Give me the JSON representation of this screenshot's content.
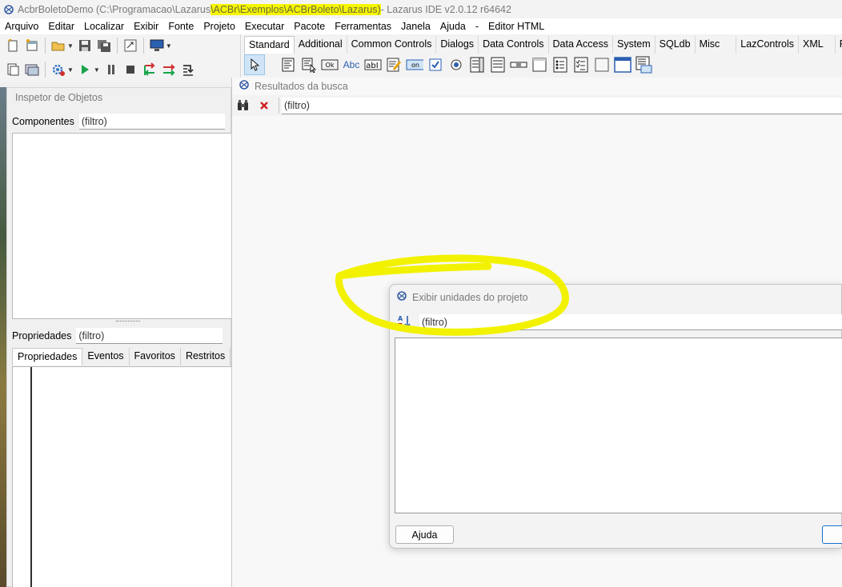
{
  "window": {
    "title_prefix": "AcbrBoletoDemo (C:\\Programacao\\Lazarus",
    "title_highlight": "\\ACBr\\Exemplos\\ACBrBoleto\\Lazarus)",
    "title_suffix": " - Lazarus IDE v2.0.12 r64642"
  },
  "menu": [
    "Arquivo",
    "Editar",
    "Localizar",
    "Exibir",
    "Fonte",
    "Projeto",
    "Executar",
    "Pacote",
    "Ferramentas",
    "Janela",
    "Ajuda",
    "-",
    "Editor HTML"
  ],
  "palette": {
    "tabs": [
      "Standard",
      "Additional",
      "Common Controls",
      "Dialogs",
      "Data Controls",
      "Data Access",
      "System",
      "SQLdb",
      "Misc",
      "LazControls",
      "XML",
      "Pasca"
    ],
    "active_tab": "Standard",
    "ok_label": "Ok",
    "abc_label": "Abc",
    "abi_label": "abI",
    "on_label": "on"
  },
  "inspector": {
    "title": "Inspetor de Objetos",
    "components_label": "Componentes",
    "components_filter": "(filtro)",
    "properties_label": "Propriedades",
    "properties_filter": "(filtro)",
    "tabs": [
      "Propriedades",
      "Eventos",
      "Favoritos",
      "Restritos"
    ]
  },
  "search_results": {
    "title": "Resultados da busca",
    "filter": "(filtro)"
  },
  "dialog": {
    "title": "Exibir unidades do projeto",
    "filter": "(filtro)",
    "help_button": "Ajuda"
  },
  "colors": {
    "highlight": "#f6f600",
    "annotation": "#f2f200",
    "accent": "#1a6fce"
  }
}
